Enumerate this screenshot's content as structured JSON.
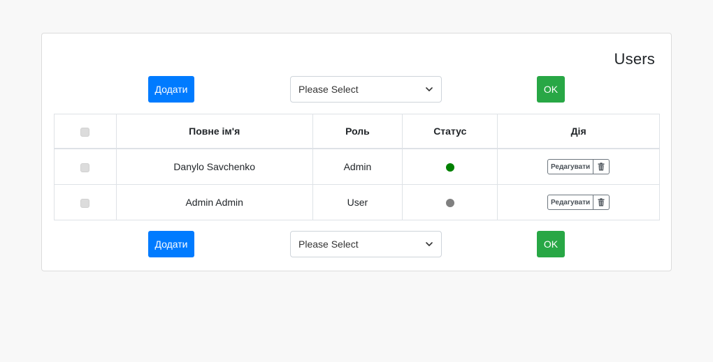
{
  "page": {
    "title": "Users"
  },
  "toolbar_top": {
    "add_label": "Додати",
    "select_value": "Please Select",
    "ok_label": "OK"
  },
  "toolbar_bottom": {
    "add_label": "Додати",
    "select_value": "Please Select",
    "ok_label": "OK"
  },
  "table": {
    "headers": {
      "full_name": "Повне ім'я",
      "role": "Роль",
      "status": "Статус",
      "action": "Дія"
    },
    "rows": [
      {
        "name": "Danylo Savchenko",
        "role": "Admin",
        "status_color": "#008000",
        "edit_label": "Редагувати"
      },
      {
        "name": "Admin Admin",
        "role": "User",
        "status_color": "#808080",
        "edit_label": "Редагувати"
      }
    ]
  },
  "colors": {
    "primary": "#007bff",
    "success": "#28a745",
    "active_status": "#008000",
    "inactive_status": "#808080"
  },
  "icons": {
    "dropdown": "chevron-down-icon",
    "delete": "trash-icon"
  }
}
